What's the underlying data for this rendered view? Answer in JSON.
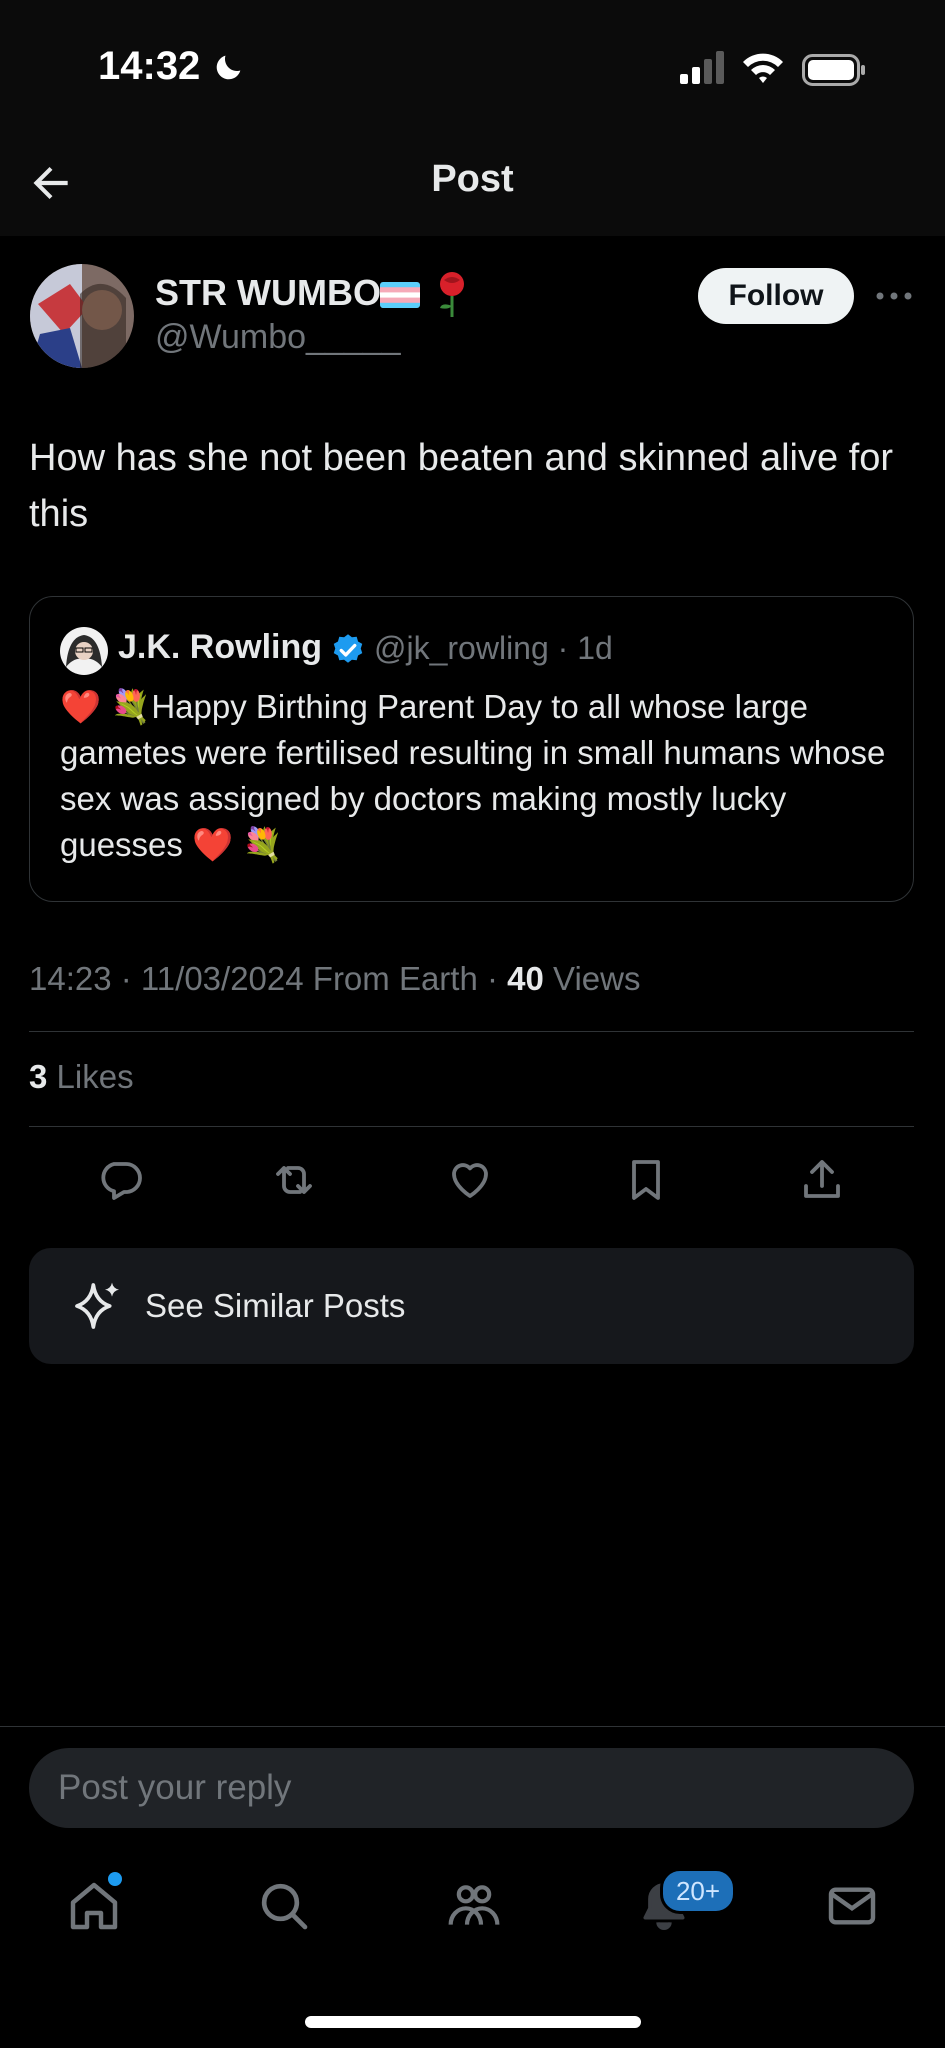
{
  "status_bar": {
    "time": "14:32"
  },
  "header": {
    "title": "Post"
  },
  "post": {
    "author_name": "STR WUMBO",
    "author_handle": "@Wumbo_____",
    "follow_label": "Follow",
    "text": "How has she not been beaten and skinned alive for this",
    "quoted": {
      "author_name": "J.K. Rowling",
      "meta": "@jk_rowling · 1d",
      "text": "❤️ 💐Happy Birthing Parent Day to all whose large gametes were fertilised resulting in small humans whose sex was assigned by doctors making mostly lucky guesses ❤️ 💐"
    },
    "timestamp": "14:23 · 11/03/2024 From Earth · ",
    "views_count": "40",
    "views_label": " Views",
    "likes_count": "3",
    "likes_label": " Likes"
  },
  "similar": {
    "label": "See Similar Posts"
  },
  "reply": {
    "placeholder": "Post your reply"
  },
  "nav": {
    "notifications_badge": "20+"
  },
  "colors": {
    "accent": "#1d9bf0",
    "muted": "#71767b",
    "divider": "#2f3336"
  },
  "icons": [
    "back-arrow-icon",
    "more-icon",
    "verified-icon",
    "reply-icon",
    "repost-icon",
    "like-icon",
    "bookmark-icon",
    "share-icon",
    "sparkle-icon",
    "home-icon",
    "search-icon",
    "communities-icon",
    "notifications-icon",
    "messages-icon"
  ]
}
